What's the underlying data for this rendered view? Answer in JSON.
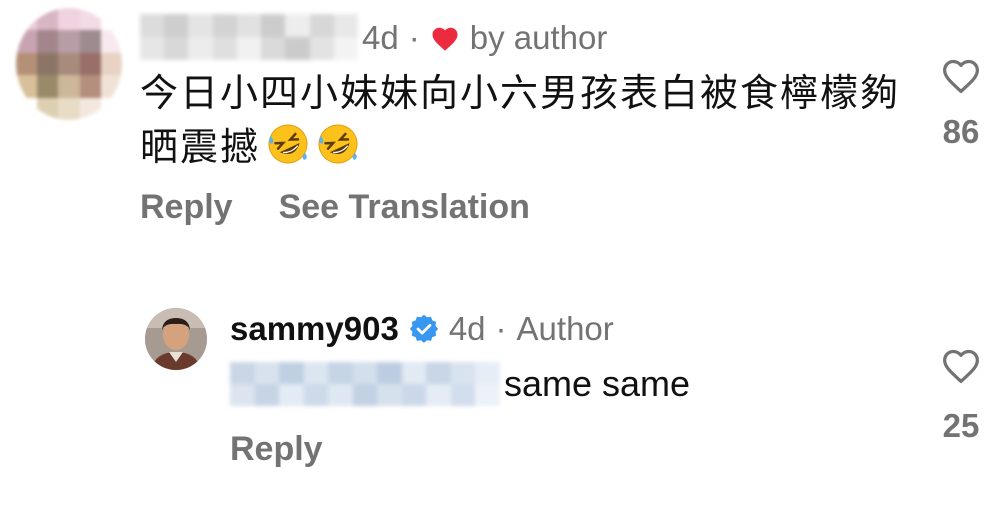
{
  "comment": {
    "time_ago": "4d",
    "separator": "·",
    "liked_by": "by author",
    "text": "今日小四小妹妹向小六男孩表白被食檸檬夠晒震撼",
    "emojis": [
      "rolling-on-the-floor-laughing",
      "rolling-on-the-floor-laughing"
    ],
    "actions": {
      "reply": "Reply",
      "see_translation": "See Translation"
    },
    "like_count": "86"
  },
  "reply": {
    "username": "sammy903",
    "time_ago": "4d",
    "separator": "·",
    "badge": "Author",
    "text": "same same",
    "actions": {
      "reply": "Reply"
    },
    "like_count": "25"
  },
  "colors": {
    "muted": "#737373",
    "heart_red": "#ed2b3e",
    "verified_blue": "#3897f0",
    "text": "#111111"
  }
}
